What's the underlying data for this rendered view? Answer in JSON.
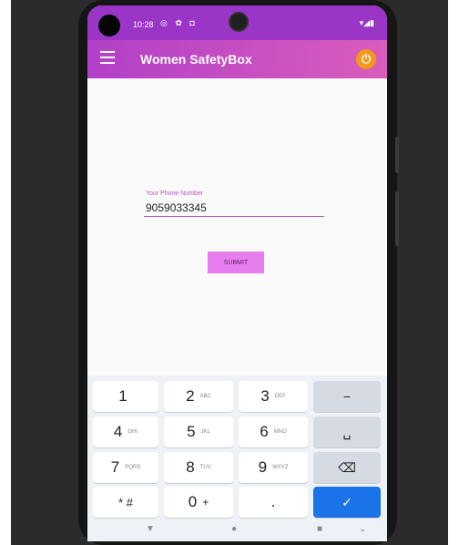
{
  "status_bar": {
    "time": "10:28",
    "left_icons": "◎ ✿ ◘",
    "right_icons": "▾◢▮"
  },
  "app_bar": {
    "title": "Women SafetyBox",
    "power_glyph": "⏻"
  },
  "form": {
    "label": "Your Phone Number",
    "phone_value": "9059033345",
    "submit_label": "SUBMIT"
  },
  "keyboard": {
    "keys": [
      {
        "digit": "1",
        "letters": ""
      },
      {
        "digit": "2",
        "letters": "ABC"
      },
      {
        "digit": "3",
        "letters": "DEF"
      },
      {
        "digit": "4",
        "letters": "GHI"
      },
      {
        "digit": "5",
        "letters": "JKL"
      },
      {
        "digit": "6",
        "letters": "MNO"
      },
      {
        "digit": "7",
        "letters": "PQRS"
      },
      {
        "digit": "8",
        "letters": "TUV"
      },
      {
        "digit": "9",
        "letters": "WXYZ"
      },
      {
        "digit": "* #",
        "letters": ""
      },
      {
        "digit": "0",
        "letters": "+"
      },
      {
        "digit": ".",
        "letters": ""
      }
    ],
    "func_keys": {
      "minus": "−",
      "space": "␣",
      "backspace": "⌫",
      "done": "✓"
    }
  },
  "nav_bar": {
    "back": "▼",
    "home": "●",
    "recents": "■",
    "keyboard": "⌄"
  },
  "colors": {
    "status_bar": "#9a35c7",
    "app_bar": "#c44cc4",
    "accent": "#c054b0",
    "submit": "#e67ef0",
    "done_key": "#1a73e8",
    "power": "#f2991c"
  }
}
